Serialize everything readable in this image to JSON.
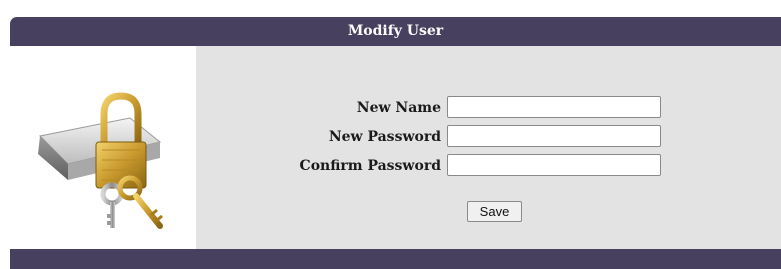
{
  "dialog": {
    "title": "Modify User",
    "icon": "lock-keys-drive-icon"
  },
  "form": {
    "fields": [
      {
        "label": "New Name",
        "value": "",
        "type": "text"
      },
      {
        "label": "New Password",
        "value": "",
        "type": "password"
      },
      {
        "label": "Confirm Password",
        "value": "",
        "type": "password"
      }
    ],
    "save_label": "Save"
  },
  "colors": {
    "header": "#47405f",
    "form_background": "#e3e3e3",
    "icon_background": "#ffffff"
  }
}
